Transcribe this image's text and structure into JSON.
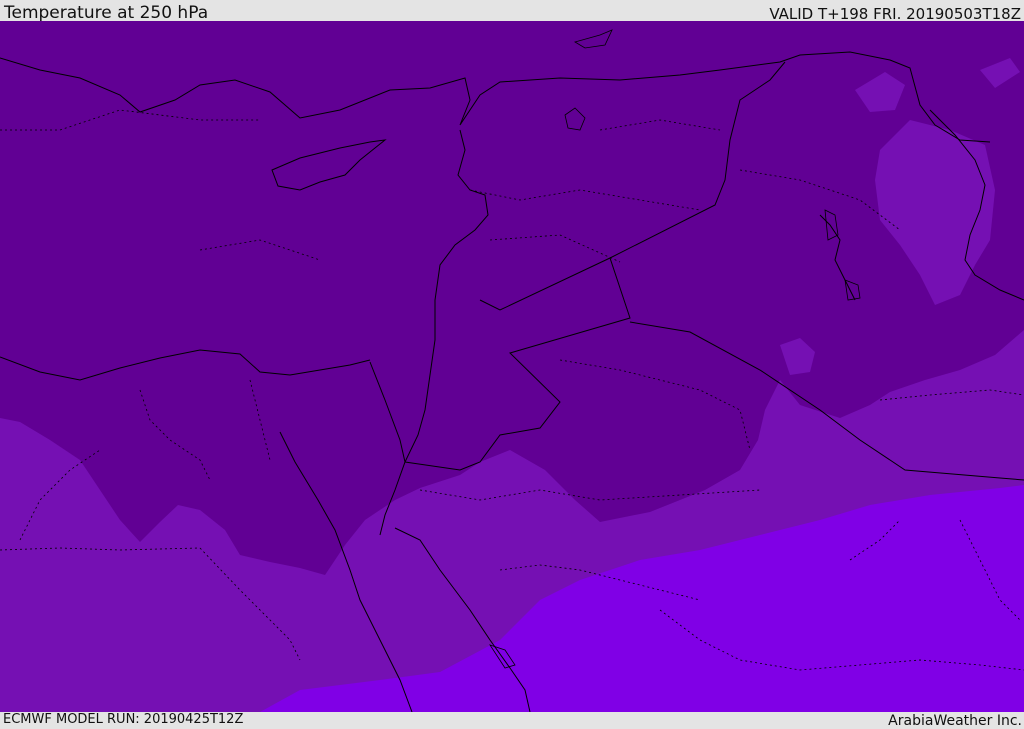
{
  "header": {
    "title": "Temperature at 250 hPa",
    "valid": "VALID T+198 FRI. 20190503T18Z"
  },
  "footer": {
    "model_run": "ECMWF MODEL RUN: 20190425T12Z",
    "credit": "ArabiaWeather Inc."
  },
  "colors": {
    "background": "#e4e4e4",
    "fill_cold": "#610094",
    "fill_mid": "#7510b3",
    "fill_warm": "#8000e6",
    "coastline": "#000000"
  }
}
